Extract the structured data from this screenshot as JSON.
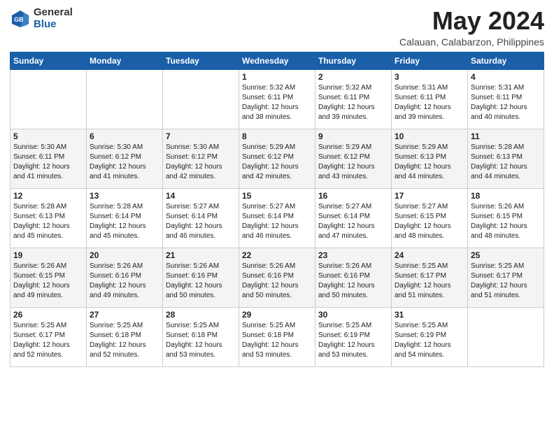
{
  "header": {
    "logo_general": "General",
    "logo_blue": "Blue",
    "title": "May 2024",
    "location": "Calauan, Calabarzon, Philippines"
  },
  "weekdays": [
    "Sunday",
    "Monday",
    "Tuesday",
    "Wednesday",
    "Thursday",
    "Friday",
    "Saturday"
  ],
  "weeks": [
    [
      {
        "day": "",
        "detail": ""
      },
      {
        "day": "",
        "detail": ""
      },
      {
        "day": "",
        "detail": ""
      },
      {
        "day": "1",
        "detail": "Sunrise: 5:32 AM\nSunset: 6:11 PM\nDaylight: 12 hours\nand 38 minutes."
      },
      {
        "day": "2",
        "detail": "Sunrise: 5:32 AM\nSunset: 6:11 PM\nDaylight: 12 hours\nand 39 minutes."
      },
      {
        "day": "3",
        "detail": "Sunrise: 5:31 AM\nSunset: 6:11 PM\nDaylight: 12 hours\nand 39 minutes."
      },
      {
        "day": "4",
        "detail": "Sunrise: 5:31 AM\nSunset: 6:11 PM\nDaylight: 12 hours\nand 40 minutes."
      }
    ],
    [
      {
        "day": "5",
        "detail": "Sunrise: 5:30 AM\nSunset: 6:11 PM\nDaylight: 12 hours\nand 41 minutes."
      },
      {
        "day": "6",
        "detail": "Sunrise: 5:30 AM\nSunset: 6:12 PM\nDaylight: 12 hours\nand 41 minutes."
      },
      {
        "day": "7",
        "detail": "Sunrise: 5:30 AM\nSunset: 6:12 PM\nDaylight: 12 hours\nand 42 minutes."
      },
      {
        "day": "8",
        "detail": "Sunrise: 5:29 AM\nSunset: 6:12 PM\nDaylight: 12 hours\nand 42 minutes."
      },
      {
        "day": "9",
        "detail": "Sunrise: 5:29 AM\nSunset: 6:12 PM\nDaylight: 12 hours\nand 43 minutes."
      },
      {
        "day": "10",
        "detail": "Sunrise: 5:29 AM\nSunset: 6:13 PM\nDaylight: 12 hours\nand 44 minutes."
      },
      {
        "day": "11",
        "detail": "Sunrise: 5:28 AM\nSunset: 6:13 PM\nDaylight: 12 hours\nand 44 minutes."
      }
    ],
    [
      {
        "day": "12",
        "detail": "Sunrise: 5:28 AM\nSunset: 6:13 PM\nDaylight: 12 hours\nand 45 minutes."
      },
      {
        "day": "13",
        "detail": "Sunrise: 5:28 AM\nSunset: 6:14 PM\nDaylight: 12 hours\nand 45 minutes."
      },
      {
        "day": "14",
        "detail": "Sunrise: 5:27 AM\nSunset: 6:14 PM\nDaylight: 12 hours\nand 46 minutes."
      },
      {
        "day": "15",
        "detail": "Sunrise: 5:27 AM\nSunset: 6:14 PM\nDaylight: 12 hours\nand 46 minutes."
      },
      {
        "day": "16",
        "detail": "Sunrise: 5:27 AM\nSunset: 6:14 PM\nDaylight: 12 hours\nand 47 minutes."
      },
      {
        "day": "17",
        "detail": "Sunrise: 5:27 AM\nSunset: 6:15 PM\nDaylight: 12 hours\nand 48 minutes."
      },
      {
        "day": "18",
        "detail": "Sunrise: 5:26 AM\nSunset: 6:15 PM\nDaylight: 12 hours\nand 48 minutes."
      }
    ],
    [
      {
        "day": "19",
        "detail": "Sunrise: 5:26 AM\nSunset: 6:15 PM\nDaylight: 12 hours\nand 49 minutes."
      },
      {
        "day": "20",
        "detail": "Sunrise: 5:26 AM\nSunset: 6:16 PM\nDaylight: 12 hours\nand 49 minutes."
      },
      {
        "day": "21",
        "detail": "Sunrise: 5:26 AM\nSunset: 6:16 PM\nDaylight: 12 hours\nand 50 minutes."
      },
      {
        "day": "22",
        "detail": "Sunrise: 5:26 AM\nSunset: 6:16 PM\nDaylight: 12 hours\nand 50 minutes."
      },
      {
        "day": "23",
        "detail": "Sunrise: 5:26 AM\nSunset: 6:16 PM\nDaylight: 12 hours\nand 50 minutes."
      },
      {
        "day": "24",
        "detail": "Sunrise: 5:25 AM\nSunset: 6:17 PM\nDaylight: 12 hours\nand 51 minutes."
      },
      {
        "day": "25",
        "detail": "Sunrise: 5:25 AM\nSunset: 6:17 PM\nDaylight: 12 hours\nand 51 minutes."
      }
    ],
    [
      {
        "day": "26",
        "detail": "Sunrise: 5:25 AM\nSunset: 6:17 PM\nDaylight: 12 hours\nand 52 minutes."
      },
      {
        "day": "27",
        "detail": "Sunrise: 5:25 AM\nSunset: 6:18 PM\nDaylight: 12 hours\nand 52 minutes."
      },
      {
        "day": "28",
        "detail": "Sunrise: 5:25 AM\nSunset: 6:18 PM\nDaylight: 12 hours\nand 53 minutes."
      },
      {
        "day": "29",
        "detail": "Sunrise: 5:25 AM\nSunset: 6:18 PM\nDaylight: 12 hours\nand 53 minutes."
      },
      {
        "day": "30",
        "detail": "Sunrise: 5:25 AM\nSunset: 6:19 PM\nDaylight: 12 hours\nand 53 minutes."
      },
      {
        "day": "31",
        "detail": "Sunrise: 5:25 AM\nSunset: 6:19 PM\nDaylight: 12 hours\nand 54 minutes."
      },
      {
        "day": "",
        "detail": ""
      }
    ]
  ]
}
